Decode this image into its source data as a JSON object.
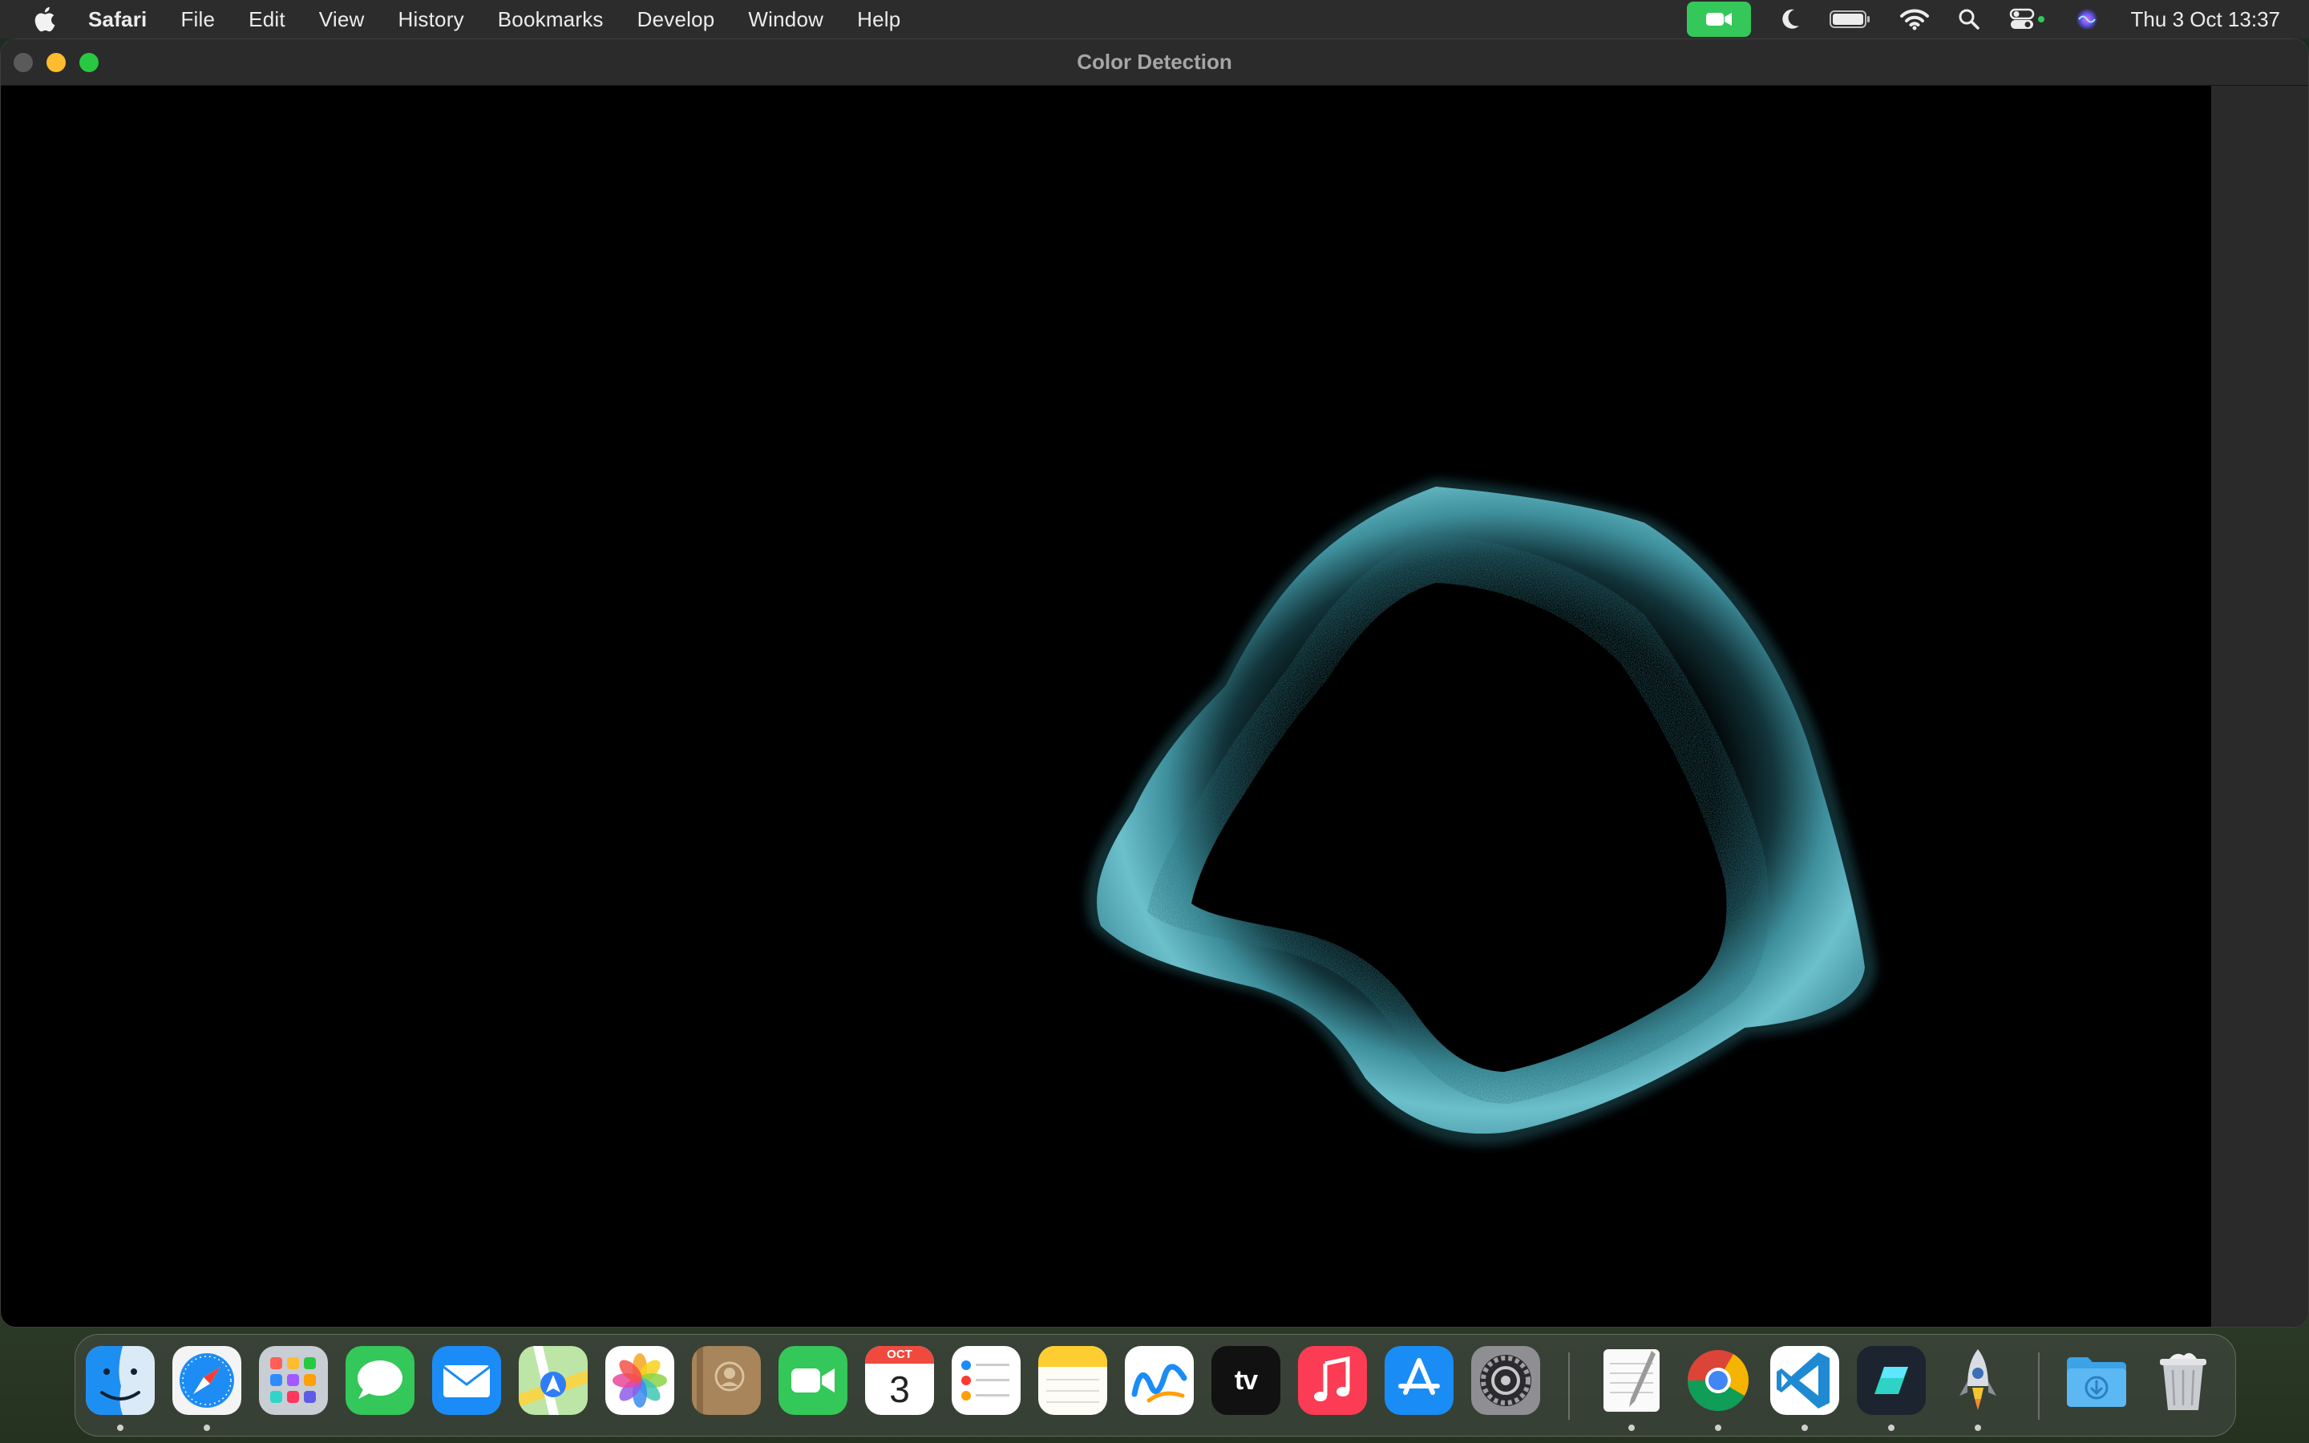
{
  "menubar": {
    "apple_icon": "apple-logo-icon",
    "app_name": "Safari",
    "items": [
      "File",
      "Edit",
      "View",
      "History",
      "Bookmarks",
      "Develop",
      "Window",
      "Help"
    ],
    "status_icons": [
      "facetime-icon",
      "moon-icon",
      "battery-icon",
      "wifi-icon",
      "search-icon",
      "control-center-icon",
      "siri-icon"
    ],
    "clock": "Thu 3 Oct  13:37"
  },
  "window": {
    "title": "Color Detection",
    "content_background": "#000000",
    "detected_region_color": "#5fb3c2"
  },
  "dock": {
    "apps": [
      {
        "name": "Finder",
        "icon": "finder-icon",
        "running": true
      },
      {
        "name": "Safari",
        "icon": "safari-icon",
        "running": true
      },
      {
        "name": "Launchpad",
        "icon": "launchpad-icon",
        "running": false
      },
      {
        "name": "Messages",
        "icon": "messages-icon",
        "running": false
      },
      {
        "name": "Mail",
        "icon": "mail-icon",
        "running": false
      },
      {
        "name": "Maps",
        "icon": "maps-icon",
        "running": false
      },
      {
        "name": "Photos",
        "icon": "photos-icon",
        "running": false
      },
      {
        "name": "Contacts",
        "icon": "contacts-icon",
        "running": false
      },
      {
        "name": "FaceTime",
        "icon": "facetime-icon",
        "running": false
      },
      {
        "name": "Calendar",
        "icon": "calendar-icon",
        "running": false
      },
      {
        "name": "Reminders",
        "icon": "reminders-icon",
        "running": false
      },
      {
        "name": "Notes",
        "icon": "notes-icon",
        "running": false
      },
      {
        "name": "Freeform",
        "icon": "freeform-icon",
        "running": false
      },
      {
        "name": "TV",
        "icon": "apple-tv-icon",
        "running": false
      },
      {
        "name": "Music",
        "icon": "music-icon",
        "running": false
      },
      {
        "name": "App Store",
        "icon": "app-store-icon",
        "running": false
      },
      {
        "name": "System Settings",
        "icon": "system-settings-icon",
        "running": false
      },
      {
        "name": "TextEdit",
        "icon": "textedit-icon",
        "running": true
      },
      {
        "name": "Chrome",
        "icon": "chrome-icon",
        "running": true
      },
      {
        "name": "VS Code",
        "icon": "vscode-icon",
        "running": true
      },
      {
        "name": "Notchmeister",
        "icon": "app-icon",
        "running": true
      },
      {
        "name": "Python Launcher",
        "icon": "python-rocket-icon",
        "running": true
      },
      {
        "name": "Downloads",
        "icon": "downloads-folder-icon",
        "running": false
      },
      {
        "name": "Trash",
        "icon": "trash-icon",
        "running": false
      }
    ],
    "calendar_month": "OCT",
    "calendar_day": "3",
    "tv_label": "tv"
  }
}
